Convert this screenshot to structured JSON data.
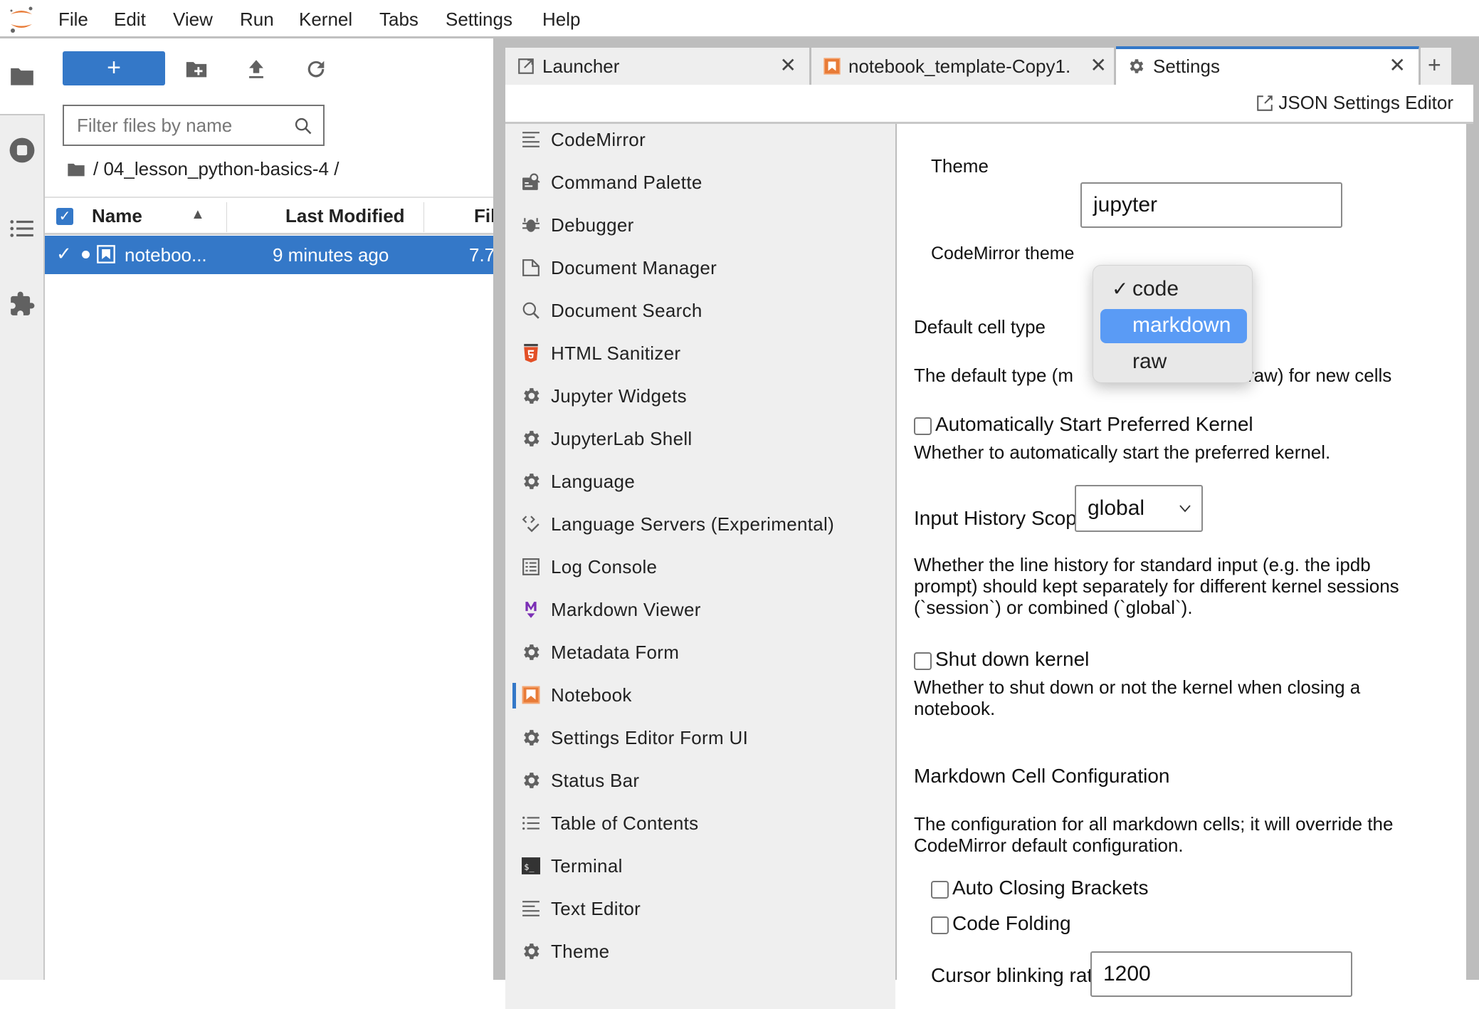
{
  "menubar": {
    "items": [
      "File",
      "Edit",
      "View",
      "Run",
      "Kernel",
      "Tabs",
      "Settings",
      "Help"
    ]
  },
  "left_sidebar": {
    "icons": [
      "folder-icon",
      "running-stop-icon",
      "table-of-contents-icon",
      "extension-puzzle-icon"
    ]
  },
  "file_browser": {
    "new_button_label": "+",
    "filter_placeholder": "Filter files by name",
    "breadcrumb": "/ 04_lesson_python-basics-4 /",
    "columns": {
      "name": "Name",
      "last_modified": "Last Modified",
      "file_size": "Fil"
    },
    "files": [
      {
        "name": "noteboo...",
        "modified": "9 minutes ago",
        "size": "7.7",
        "selected": true,
        "running": true
      }
    ]
  },
  "tabs": [
    {
      "label": "Launcher",
      "icon": "launcher-icon",
      "active": false
    },
    {
      "label": "notebook_template-Copy1.",
      "icon": "notebook-icon",
      "active": false
    },
    {
      "label": "Settings",
      "icon": "gear-icon",
      "active": true
    }
  ],
  "tab_close_glyph": "✕",
  "tab_add_glyph": "+",
  "settings_toolbar": {
    "json_editor_label": "JSON Settings Editor"
  },
  "settings_list": [
    {
      "label": "CodeMirror",
      "icon": "text-lines-icon"
    },
    {
      "label": "Command Palette",
      "icon": "command-palette-icon"
    },
    {
      "label": "Debugger",
      "icon": "bug-icon"
    },
    {
      "label": "Document Manager",
      "icon": "file-icon"
    },
    {
      "label": "Document Search",
      "icon": "search-icon"
    },
    {
      "label": "HTML Sanitizer",
      "icon": "html5-icon"
    },
    {
      "label": "Jupyter Widgets",
      "icon": "gear-icon"
    },
    {
      "label": "JupyterLab Shell",
      "icon": "gear-icon"
    },
    {
      "label": "Language",
      "icon": "gear-icon"
    },
    {
      "label": "Language Servers (Experimental)",
      "icon": "code-check-icon"
    },
    {
      "label": "Log Console",
      "icon": "list-box-icon"
    },
    {
      "label": "Markdown Viewer",
      "icon": "markdown-icon"
    },
    {
      "label": "Metadata Form",
      "icon": "gear-icon"
    },
    {
      "label": "Notebook",
      "icon": "notebook-icon",
      "active": true
    },
    {
      "label": "Settings Editor Form UI",
      "icon": "gear-icon"
    },
    {
      "label": "Status Bar",
      "icon": "gear-icon"
    },
    {
      "label": "Table of Contents",
      "icon": "bullet-list-icon"
    },
    {
      "label": "Terminal",
      "icon": "terminal-icon"
    },
    {
      "label": "Text Editor",
      "icon": "text-lines-icon"
    },
    {
      "label": "Theme",
      "icon": "gear-icon"
    }
  ],
  "form": {
    "theme_label": "Theme",
    "theme_value": "jupyter",
    "theme_desc": "CodeMirror theme",
    "default_cell_type_label": "Default cell type",
    "default_cell_type_desc_left": "The default type (m",
    "default_cell_type_desc_right": "raw) for new cells",
    "default_cell_type_options": [
      {
        "label": "code",
        "checked": true,
        "highlighted": false
      },
      {
        "label": "markdown",
        "checked": false,
        "highlighted": true
      },
      {
        "label": "raw",
        "checked": false,
        "highlighted": false
      }
    ],
    "check_glyph": "✓",
    "auto_start_label": "Automatically Start Preferred Kernel",
    "auto_start_checked": false,
    "auto_start_desc": "Whether to automatically start the preferred kernel.",
    "input_history_label": "Input History Scope",
    "input_history_value": "global",
    "input_history_desc": [
      "Whether the line history for standard input (e.g. the ipdb",
      "prompt) should kept separately for different kernel sessions",
      "(`session`) or combined (`global`)."
    ],
    "shutdown_label": "Shut down kernel",
    "shutdown_checked": false,
    "shutdown_desc": [
      "Whether to shut down or not the kernel when closing a",
      "notebook."
    ],
    "markdown_config_title": "Markdown Cell Configuration",
    "markdown_config_desc": [
      "The configuration for all markdown cells; it will override the",
      "CodeMirror default configuration."
    ],
    "auto_closing_label": "Auto Closing Brackets",
    "auto_closing_checked": false,
    "code_folding_label": "Code Folding",
    "code_folding_checked": false,
    "cursor_blink_label": "Cursor blinking rate",
    "cursor_blink_value": "1200"
  },
  "colors": {
    "accent": "#3478c8",
    "jupyter_orange": "#e87b37",
    "highlight_option": "#5a9bf5",
    "markdown_purple": "#7b2fb5",
    "html5_red": "#e34f26"
  }
}
